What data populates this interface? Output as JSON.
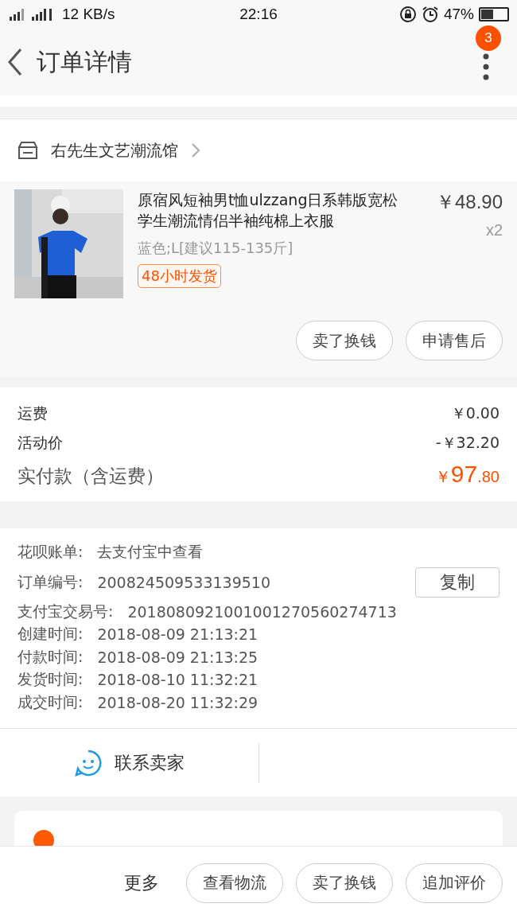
{
  "status_bar": {
    "network": "12 KB/s",
    "time": "22:16",
    "battery": "47%"
  },
  "header": {
    "title": "订单详情",
    "badge": "3"
  },
  "shop": {
    "name": "右先生文艺潮流馆"
  },
  "item": {
    "kind": "picture",
    "title": "原宿风短袖男t恤ulzzang日系韩版宽松学生潮流情侣半袖纯棉上衣服",
    "price": "￥48.90",
    "quantity": "x2",
    "variant": "蓝色;L[建议115-135斤]",
    "tag": "48小时发货",
    "buttons": [
      "卖了换钱",
      "申请售后"
    ]
  },
  "fees": [
    {
      "label": "运费",
      "value": "￥0.00"
    },
    {
      "label": "活动价",
      "value": "-￥32.20"
    }
  ],
  "total": {
    "label": "实付款（含运费）",
    "currency": "￥",
    "integer": "97",
    "decimal": ".80"
  },
  "info": [
    {
      "label": "花呗账单:",
      "value": "去支付宝中查看"
    },
    {
      "label": "订单编号:",
      "value": "200824509533139510",
      "action": "复制"
    },
    {
      "label": "支付宝交易号:",
      "value": "2018080921001001270560274713"
    },
    {
      "label": "创建时间:",
      "value": "2018-08-09 21:13:21"
    },
    {
      "label": "付款时间:",
      "value": "2018-08-09 21:13:25"
    },
    {
      "label": "发货时间:",
      "value": "2018-08-10 11:32:21"
    },
    {
      "label": "成交时间:",
      "value": "2018-08-20 11:32:29"
    }
  ],
  "contact": {
    "label": "联系卖家"
  },
  "bottom_bar": {
    "more": "更多",
    "buttons": [
      "查看物流",
      "卖了换钱",
      "追加评价"
    ]
  }
}
